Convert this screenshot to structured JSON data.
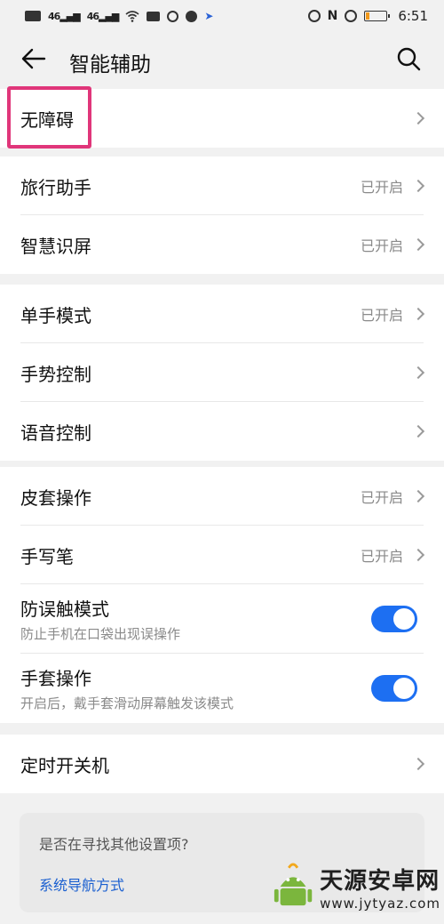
{
  "status_bar": {
    "left_icons": [
      "hd-icon",
      "signal-4g-icon",
      "signal-4g-icon",
      "wifi-icon",
      "briefcase-icon",
      "app-icon",
      "app2-icon",
      "arrow-icon"
    ],
    "signal_label": "46",
    "time": "6:51",
    "right_icons": [
      "vibrate-icon",
      "nfc-icon",
      "alarm-icon",
      "battery-icon"
    ],
    "battery_level": 0.2
  },
  "header": {
    "title": "智能辅助"
  },
  "groups": [
    {
      "items": [
        {
          "label": "无障碍",
          "status": ""
        }
      ]
    },
    {
      "items": [
        {
          "label": "旅行助手",
          "status": "已开启"
        },
        {
          "label": "智慧识屏",
          "status": "已开启"
        }
      ]
    },
    {
      "items": [
        {
          "label": "单手模式",
          "status": "已开启"
        },
        {
          "label": "手势控制",
          "status": ""
        },
        {
          "label": "语音控制",
          "status": ""
        }
      ]
    },
    {
      "items": [
        {
          "label": "皮套操作",
          "status": "已开启"
        },
        {
          "label": "手写笔",
          "status": "已开启"
        },
        {
          "label": "防误触模式",
          "sub": "防止手机在口袋出现误操作",
          "toggle": true
        },
        {
          "label": "手套操作",
          "sub": "开启后，戴手套滑动屏幕触发该模式",
          "toggle": true
        }
      ]
    },
    {
      "items": [
        {
          "label": "定时开关机",
          "status": ""
        }
      ]
    }
  ],
  "suggestion": {
    "question": "是否在寻找其他设置项?",
    "link": "系统导航方式"
  },
  "watermark": {
    "name": "天源安卓网",
    "url": "www.jytyaz.com"
  },
  "colors": {
    "toggle_on": "#1d6ff2",
    "highlight": "#e0367a",
    "link": "#1a5fd0"
  }
}
